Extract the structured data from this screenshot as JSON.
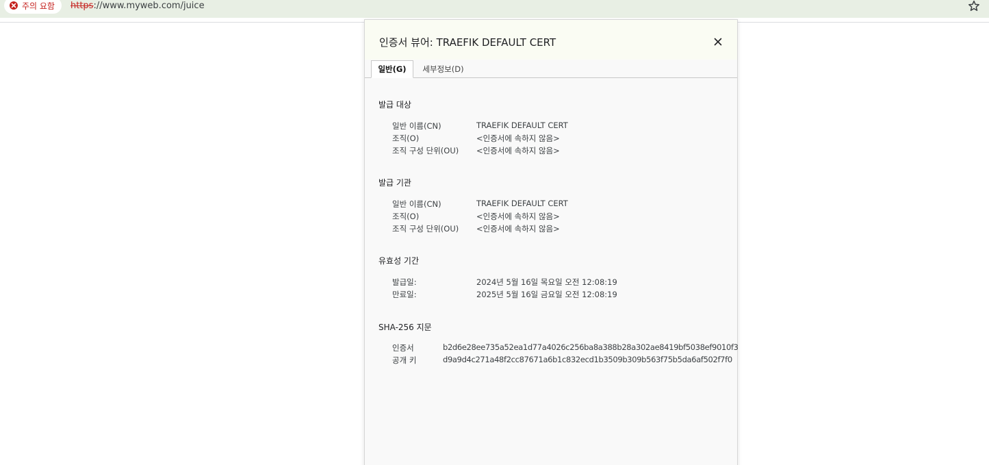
{
  "browser": {
    "security_chip": "주의 요함",
    "url_scheme": "https",
    "url_rest": "://www.myweb.com/juice",
    "bookmark_icon": "star-icon"
  },
  "dialog": {
    "title": "인증서 뷰어: TRAEFIK DEFAULT CERT",
    "close_icon": "close-icon",
    "tabs": [
      "일반(G)",
      "세부정보(D)"
    ],
    "issued_to": {
      "heading": "발급 대상",
      "rows": [
        {
          "label": "일반 이름(CN)",
          "value": "TRAEFIK DEFAULT CERT"
        },
        {
          "label": "조직(O)",
          "value": "<인증서에 속하지 않음>"
        },
        {
          "label": "조직 구성 단위(OU)",
          "value": "<인증서에 속하지 않음>"
        }
      ]
    },
    "issued_by": {
      "heading": "발급 기관",
      "rows": [
        {
          "label": "일반 이름(CN)",
          "value": "TRAEFIK DEFAULT CERT"
        },
        {
          "label": "조직(O)",
          "value": "<인증서에 속하지 않음>"
        },
        {
          "label": "조직 구성 단위(OU)",
          "value": "<인증서에 속하지 않음>"
        }
      ]
    },
    "validity": {
      "heading": "유효성 기간",
      "rows": [
        {
          "label": "발급일:",
          "value": "2024년 5월 16일 목요일 오전 12:08:19"
        },
        {
          "label": "만료일:",
          "value": "2025년 5월 16일 금요일 오전 12:08:19"
        }
      ]
    },
    "fingerprints": {
      "heading": "SHA-256 지문",
      "rows": [
        {
          "label": "인증서",
          "value": "b2d6e28ee735a52ea1d77a4026c256ba8a388b28a302ae8419bf5038ef9010f3"
        },
        {
          "label": "공개 키",
          "value": "d9a9d4c271a48f2cc87671a6b1c832ecd1b3509b309b563f75b5da6af502f7f0"
        }
      ]
    }
  }
}
